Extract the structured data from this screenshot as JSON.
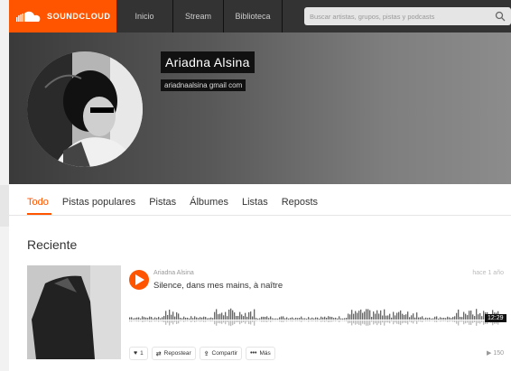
{
  "nav": {
    "logo_text": "SOUNDCLOUD",
    "links": [
      "Inicio",
      "Stream",
      "Biblioteca"
    ],
    "search_placeholder": "Buscar artistas, grupos, pistas y podcasts"
  },
  "profile": {
    "name": "Ariadna Alsina",
    "email": "ariadnaalsina gmail com"
  },
  "tabs": [
    "Todo",
    "Pistas populares",
    "Pistas",
    "Álbumes",
    "Listas",
    "Reposts"
  ],
  "active_tab": "Todo",
  "section_title": "Reciente",
  "track": {
    "artist": "Ariadna Alsina",
    "title": "Silence, dans mes mains, à naître",
    "time_ago": "hace 1 año",
    "duration": "12:29",
    "likes": "1",
    "repost_label": "Repostear",
    "share_label": "Compartir",
    "more_label": "Más",
    "plays": "150"
  },
  "colors": {
    "accent": "#ff5500",
    "nav_bg": "#333333"
  }
}
